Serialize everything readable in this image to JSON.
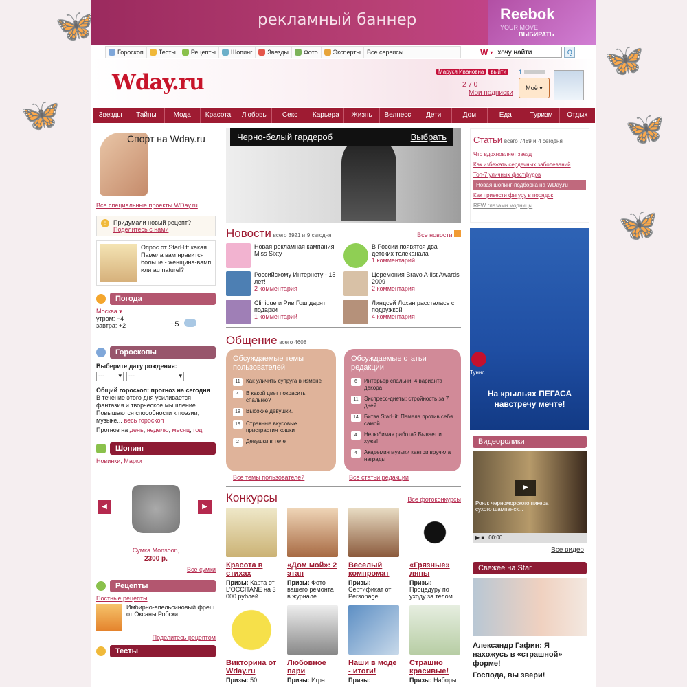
{
  "banner": {
    "text": "рекламный баннер",
    "ad_brand": "Reebok",
    "ad_line": "YOUR MOVE",
    "ad_cta": "ВЫБИРАТЬ"
  },
  "services": [
    "Гороскоп",
    "Тесты",
    "Рецепты",
    "Шопинг",
    "Звезды",
    "Фото",
    "Эксперты",
    "Все сервисы..."
  ],
  "search": {
    "logo": "W",
    "value": "хочу найти",
    "button": "Q"
  },
  "header": {
    "logo": "Wday.ru",
    "user_name": "Маруся Ивановна",
    "logout": "выйти",
    "counters": "2    7    0",
    "subscriptions": "Мои подписки",
    "moe_count": "1",
    "moe_label": "Моё"
  },
  "nav": [
    "Звезды",
    "Тайны",
    "Мода",
    "Красота",
    "Любовь",
    "Секс",
    "Карьера",
    "Жизнь",
    "Велнесс",
    "Дети",
    "Дом",
    "Еда",
    "Туризм",
    "Отдых"
  ],
  "left": {
    "promo_title": "Спорт на Wday.ru",
    "promo_link": "Все специальные проекты WDay.ru",
    "recipe_prompt": "Придумали новый рецепт?",
    "recipe_link": "Поделитесь с нами",
    "poll_text": "Опрос от StarHit: какая Памела вам нравится больше - женщина-вамп или au naturel?",
    "weather": {
      "title": "Погода",
      "city": "Москва ▾",
      "morning": "утром: −4",
      "tomorrow": "завтра: +2",
      "temp": "−5"
    },
    "horoscope": {
      "title": "Гороскопы",
      "prompt": "Выберите дату рождения:",
      "select1": "---",
      "select2": "---",
      "subtitle": "Общий гороскоп: прогноз на сегодня",
      "text": "В течение этого дня усиливается фантазия и творческое мышление. Повышаются способности к поэзии, музыке...",
      "more": "весь гороскоп",
      "forecast_label": "Прогноз на",
      "forecast_links": [
        "день",
        "неделю",
        "месяц",
        "год"
      ]
    },
    "shopping": {
      "title": "Шопинг",
      "links": "Новинки, Марки",
      "item": "Сумка Monsoon,",
      "price": "2300 р.",
      "all": "Все сумки"
    },
    "recipes": {
      "title": "Рецепты",
      "link": "Постные рецепты",
      "item": "Имбирно-апельсиновый фреш от Оксаны Робски",
      "share": "Поделитесь рецептом"
    },
    "tests": {
      "title": "Тесты"
    }
  },
  "hero": {
    "caption": "Черно-белый гардероб",
    "action": "Выбрать"
  },
  "articles": {
    "title": "Статьи",
    "total": "всего 7489 и",
    "today": "4 сегодня",
    "items": [
      "Что вдохновляет звезд",
      "Как избежать сердечных заболеваний",
      "Топ-7 уличных фастфудов",
      "Новая шопинг-подборка на WDay.ru",
      "Как привести фигуру в порядок",
      "RFW глазами модницы"
    ]
  },
  "news": {
    "title": "Новости",
    "total": "всего 3921 и",
    "today": "9 сегодня",
    "all": "Все новости",
    "items": [
      {
        "title": "Новая рекламная кампания Miss Sixty",
        "comments": ""
      },
      {
        "title": "В России появятся два детских телеканала",
        "comments": "1 комментарий"
      },
      {
        "title": "Российскому Интернету - 15 лет!",
        "comments": "2 комментария"
      },
      {
        "title": "Церемония Bravo A-list Awards 2009",
        "comments": "2 комментария"
      },
      {
        "title": "Clinique и Рив Гош дарят подарки",
        "comments": "1 комментарий"
      },
      {
        "title": "Линдсей Лохан рассталась с подружкой",
        "comments": "4 комментария"
      }
    ]
  },
  "talk": {
    "title": "Общение",
    "total": "всего 4608",
    "users_title": "Обсуждаемые темы пользователей",
    "users": [
      {
        "n": "11",
        "t": "Как уличить супруга в измене"
      },
      {
        "n": "4",
        "t": "В какой цвет покрасить спальню?"
      },
      {
        "n": "18",
        "t": "Высокие девушки."
      },
      {
        "n": "19",
        "t": "Странные вкусовые пристрастия кошки"
      },
      {
        "n": "2",
        "t": "Девушки в теле"
      }
    ],
    "users_all": "Все темы пользователей",
    "editors_title": "Обсуждаемые статьи редакции",
    "editors": [
      {
        "n": "6",
        "t": "Интерьер спальни: 4 варианта декора"
      },
      {
        "n": "11",
        "t": "Экспресс-диеты: стройность за 7 дней"
      },
      {
        "n": "14",
        "t": "Битва StarHit: Памела против себя самой"
      },
      {
        "n": "4",
        "t": "Нелюбимая работа? Бывает и хуже!"
      },
      {
        "n": "4",
        "t": "Академия музыки кантри вручила награды"
      }
    ],
    "editors_all": "Все статьи редакции"
  },
  "contests": {
    "title": "Конкурсы",
    "all": "Все фотоконкурсы",
    "items": [
      {
        "t": "Красота в стихах",
        "pl": "Призы:",
        "p": "Карта от L'OCCITANE на 3 000 рублей",
        "color": "#d9c58a"
      },
      {
        "t": "«Дом мой»: 2 этап",
        "pl": "Призы:",
        "p": "Фото вашего ремонта в журнале",
        "color": "#c9a07a"
      },
      {
        "t": "Веселый компромат",
        "pl": "Призы:",
        "p": "Сертификат от Personage",
        "color": "#b88a6a"
      },
      {
        "t": "«Грязные» ляпы",
        "pl": "Призы:",
        "p": "Процедуру по уходу за телом",
        "color": "#f2f2f2"
      },
      {
        "t": "Викторина от Wday.ru",
        "pl": "Призы:",
        "p": "50",
        "color": "#f6e04a"
      },
      {
        "t": "Любовное пари",
        "pl": "Призы:",
        "p": "Игра",
        "color": "#ddd"
      },
      {
        "t": "Наши в моде - итоги!",
        "pl": "Призы:",
        "p": "",
        "color": "#6b9ac9"
      },
      {
        "t": "Страшно красивые!",
        "pl": "Призы:",
        "p": "Наборы",
        "color": "#e6eee0"
      }
    ]
  },
  "right": {
    "ad_brand": "Тунис",
    "ad_text": "На крыльях ПЕГАСА навстречу мечте!",
    "video_title": "Видеоролики",
    "video_caption": "Роял: черноморского пикера сухого шампанск...",
    "video_time": "00:00",
    "video_all": "Все видео",
    "fresh_title": "Свежее на Star",
    "fresh_text": "Александр Гафин: Я нахожусь в «страшной» форме!",
    "fresh_more": "Господа, вы звери!"
  }
}
